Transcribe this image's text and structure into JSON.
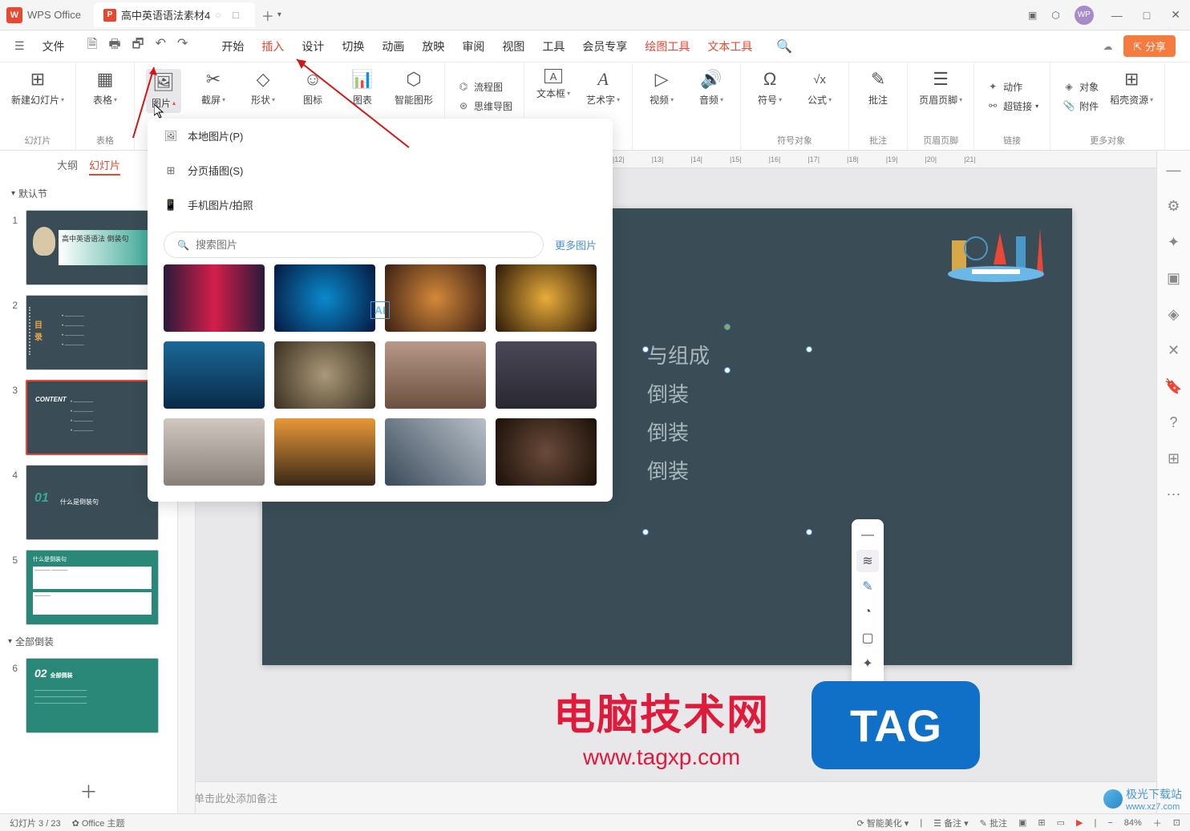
{
  "titlebar": {
    "app_name": "WPS Office",
    "tab_title": "高中英语语法素材4",
    "tab_icon": "P"
  },
  "menubar": {
    "file": "文件",
    "items": [
      "开始",
      "插入",
      "设计",
      "切换",
      "动画",
      "放映",
      "审阅",
      "视图",
      "工具",
      "会员专享",
      "绘图工具",
      "文本工具"
    ],
    "share": "分享"
  },
  "ribbon": {
    "groups": [
      {
        "label": "幻灯片",
        "items": [
          {
            "icon": "⊞",
            "label": "新建幻灯片",
            "caret": true
          }
        ]
      },
      {
        "label": "表格",
        "items": [
          {
            "icon": "▦",
            "label": "表格",
            "caret": true
          }
        ]
      },
      {
        "label": "",
        "items": [
          {
            "icon": "🖼",
            "label": "图片",
            "caret": true,
            "active": true
          },
          {
            "icon": "✂",
            "label": "截屏",
            "caret": true
          },
          {
            "icon": "◇",
            "label": "形状",
            "caret": true
          },
          {
            "icon": "⊙",
            "label": "图标"
          },
          {
            "icon": "📊",
            "label": "图表"
          },
          {
            "icon": "⬡",
            "label": "智能图形"
          }
        ]
      },
      {
        "label": "",
        "itemsv": [
          {
            "icon": "⌬",
            "label": "流程图"
          },
          {
            "icon": "⊛",
            "label": "思维导图"
          }
        ]
      },
      {
        "label": "",
        "items": [
          {
            "icon": "A",
            "label": "文本框",
            "caret": true
          },
          {
            "icon": "𝐀",
            "label": "艺术字",
            "caret": true
          }
        ]
      },
      {
        "label": "",
        "items": [
          {
            "icon": "▷",
            "label": "视频",
            "caret": true
          },
          {
            "icon": "🔊",
            "label": "音频",
            "caret": true
          }
        ]
      },
      {
        "label": "符号对象",
        "items": [
          {
            "icon": "Ω",
            "label": "符号",
            "caret": true
          },
          {
            "icon": "√x",
            "label": "公式",
            "caret": true
          }
        ]
      },
      {
        "label": "批注",
        "items": [
          {
            "icon": "✎",
            "label": "批注"
          }
        ]
      },
      {
        "label": "页眉页脚",
        "items": [
          {
            "icon": "☰",
            "label": "页眉页脚",
            "caret": true
          }
        ]
      },
      {
        "label": "链接",
        "itemsv": [
          {
            "icon": "✦",
            "label": "动作"
          },
          {
            "icon": "⚯",
            "label": "超链接",
            "caret": true
          }
        ]
      },
      {
        "label": "更多对象",
        "itemsv": [
          {
            "icon": "◈",
            "label": "对象"
          },
          {
            "icon": "📎",
            "label": "附件"
          }
        ],
        "extra": {
          "icon": "⊞",
          "label": "稻壳资源",
          "caret": true
        }
      }
    ]
  },
  "slide_panel": {
    "tabs": [
      "大纲",
      "幻灯片"
    ],
    "section1": "默认节",
    "section2": "全部倒装",
    "slides_count": 6,
    "selected": 3
  },
  "image_dropdown": {
    "options": [
      {
        "icon": "🖼",
        "label": "本地图片(P)"
      },
      {
        "icon": "⊞",
        "label": "分页插图(S)"
      },
      {
        "icon": "📱",
        "label": "手机图片/拍照"
      }
    ],
    "search_placeholder": "搜索图片",
    "more": "更多图片"
  },
  "canvas": {
    "text_lines": [
      "与组成",
      "倒装",
      "倒装",
      "倒装"
    ]
  },
  "notes": {
    "placeholder": "单击此处添加备注"
  },
  "statusbar": {
    "slide_pos": "幻灯片 3 / 23",
    "theme": "Office 主题",
    "enhance": "智能美化",
    "notes_btn": "备注",
    "comments_btn": "批注",
    "zoom": "84%"
  },
  "watermark": {
    "w1a": "电脑技术网",
    "w1b": "www.tagxp.com",
    "w2": "TAG",
    "w3": "极光下载站",
    "w3url": "www.xz7.com"
  }
}
